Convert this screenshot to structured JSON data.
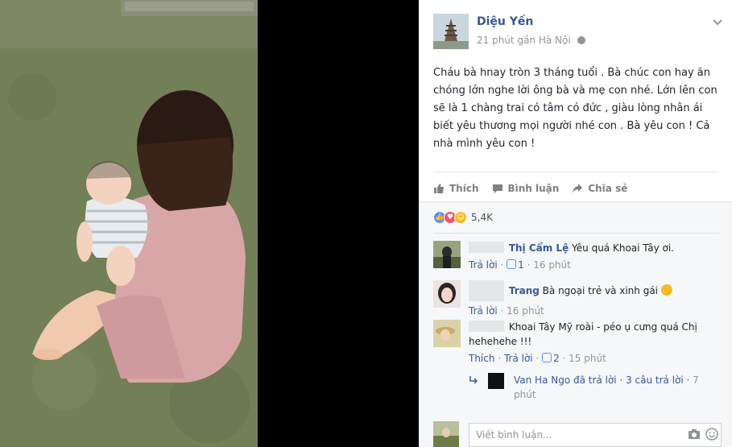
{
  "post": {
    "author": "Diệu Yến",
    "time": "21 phút",
    "location": "gần Hà Nội",
    "text": "Cháu bà hnay tròn 3 tháng tuổi . Bà chúc con hay ăn chóng lớn nghe lời ông bà và mẹ con nhé. Lớn lên con sẽ là 1 chàng trai có tâm có đức , giàu lòng nhân ái biết yêu thương mọi người nhé con . Bà yêu con ! Cả nhà mình yêu con !"
  },
  "actions": {
    "like": "Thích",
    "comment": "Bình luận",
    "share": "Chia sẻ"
  },
  "reactions": {
    "count": "5,4K"
  },
  "comments": [
    {
      "name": "Thị Cẩm Lệ",
      "text": "Yêu quá Khoai Tây ơi.",
      "reply": "Trả lời",
      "likes": "1",
      "time": "16 phút"
    },
    {
      "name": "Trang",
      "text": "Bà ngoại trẻ và xinh gái",
      "reply": "Trả lời",
      "time": "16 phút"
    },
    {
      "name": "",
      "text": "Khoai Tây Mỹ roài - péo ụ cưng quá Chị hehehehe !!!",
      "like": "Thích",
      "reply": "Trả lời",
      "likes": "2",
      "time": "15 phút"
    }
  ],
  "reply_summary": {
    "name": "Van Ha Ngo",
    "action": "đã trả lời",
    "count": "3 câu trả lời",
    "time_a": "7",
    "time_b": "phút"
  },
  "composer": {
    "placeholder": "Viết bình luận..."
  },
  "colors": {
    "link": "#365899",
    "meta": "#90949c",
    "like_blue": "#5890ff",
    "love_red": "#f25268",
    "haha_yellow": "#f7b928"
  }
}
